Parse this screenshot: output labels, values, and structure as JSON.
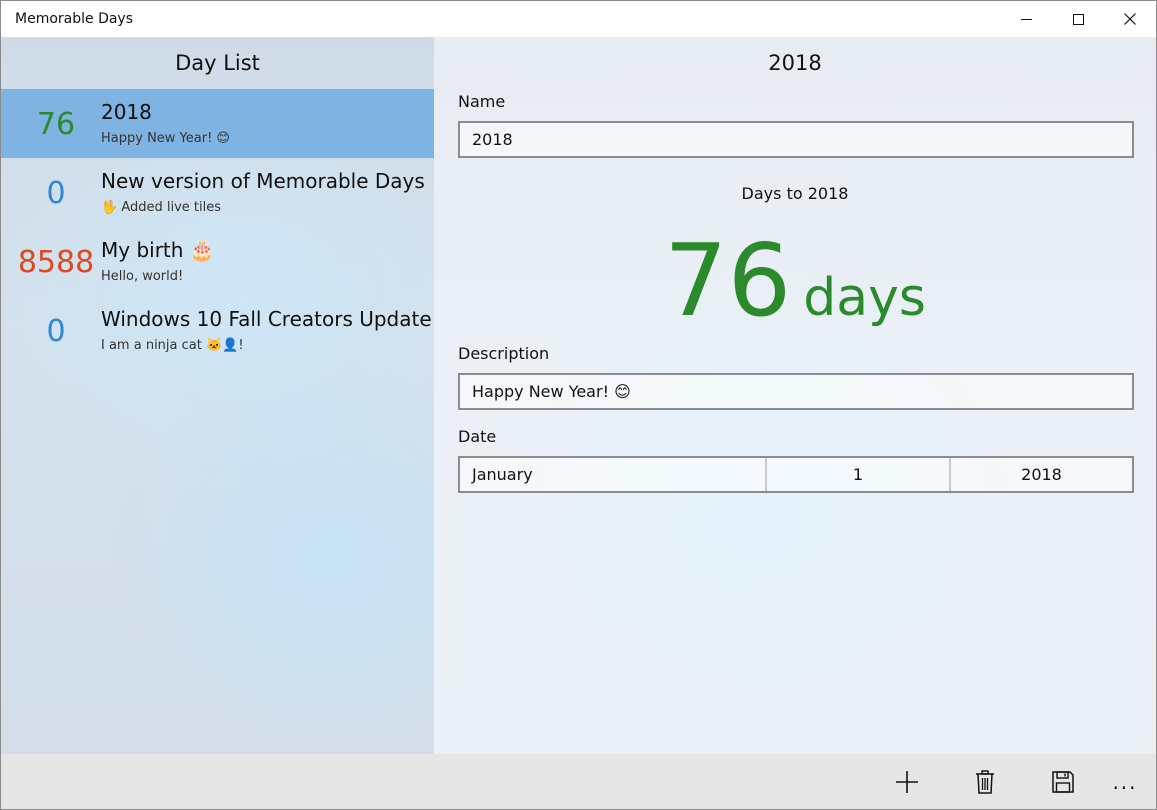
{
  "window": {
    "title": "Memorable Days"
  },
  "left_pane": {
    "header": "Day List",
    "items": [
      {
        "count": "76",
        "name": "2018",
        "description": "Happy New Year! 😊",
        "count_color": "#2b8a2b",
        "selected": true
      },
      {
        "count": "0",
        "name": "New version of Memorable Days",
        "description": "🖖 Added live tiles",
        "count_color": "#2f86d6",
        "selected": false
      },
      {
        "count": "8588",
        "name": "My birth 🎂",
        "description": "Hello, world!",
        "count_color": "#e0481d",
        "selected": false
      },
      {
        "count": "0",
        "name": "Windows 10 Fall Creators Update",
        "description": "I am a ninja cat 🐱‍👤!",
        "count_color": "#2f86d6",
        "selected": false
      }
    ]
  },
  "detail": {
    "title": "2018",
    "name_label": "Name",
    "name_value": "2018",
    "days_to_label": "Days to 2018",
    "days_count": "76",
    "days_unit": "days",
    "description_label": "Description",
    "description_value": "Happy New Year! 😊",
    "date_label": "Date",
    "date_month": "January",
    "date_day": "1",
    "date_year": "2018"
  },
  "command_bar": {
    "add_icon": "add-icon",
    "delete_icon": "delete-icon",
    "save_icon": "save-icon",
    "more_label": "..."
  },
  "colors": {
    "accent_green": "#2b8a2b",
    "accent_blue": "#2f86d6",
    "accent_orange": "#e0481d",
    "selection": "#7fb3e1"
  }
}
